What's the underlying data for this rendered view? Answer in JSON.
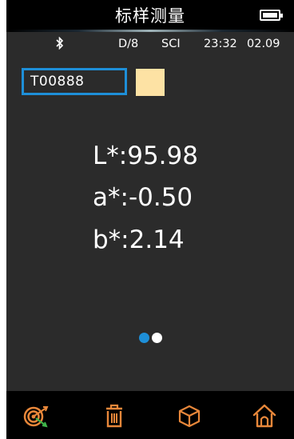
{
  "header": {
    "title": "标样测量"
  },
  "status": {
    "geometry": "D/8",
    "mode": "SCI",
    "time": "23:32",
    "date": "02.09"
  },
  "sample": {
    "name": "T00888",
    "swatch_color": "#fde2a4"
  },
  "readings": {
    "L": "L*:95.98",
    "a": "a*:-0.50",
    "b": "b*:2.14"
  },
  "pager": {
    "count": 2,
    "active_index": 0
  },
  "toolbar": {
    "items": [
      "target-icon",
      "trash-icon",
      "cube-icon",
      "home-icon"
    ]
  },
  "colors": {
    "accent_blue": "#1e8fd8",
    "icon_orange": "#e8873a"
  }
}
